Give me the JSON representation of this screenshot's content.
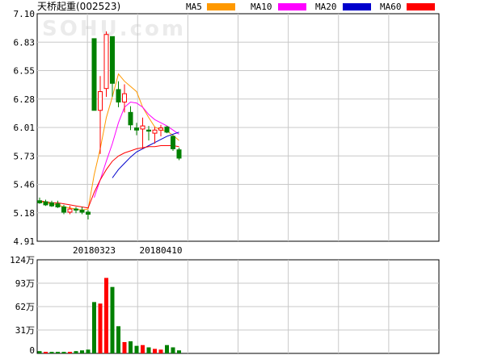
{
  "title": "天桥起重(002523)",
  "watermark": "SOHU.com",
  "legend": [
    {
      "label": "MA5",
      "color": "#ff9900"
    },
    {
      "label": "MA10",
      "color": "#ff00ff"
    },
    {
      "label": "MA20",
      "color": "#0000cc"
    },
    {
      "label": "MA60",
      "color": "#ff0000"
    }
  ],
  "chart_data": [
    {
      "type": "candlestick",
      "ylim": [
        4.91,
        7.1
      ],
      "y_ticks": [
        "7.10",
        "6.83",
        "6.55",
        "6.28",
        "6.01",
        "5.73",
        "5.46",
        "5.18",
        "4.91"
      ],
      "x_tick_labels": [
        {
          "index": 9,
          "label": "20180323"
        },
        {
          "index": 20,
          "label": "20180410"
        }
      ],
      "up_color": "#ff0000",
      "down_color": "#008000",
      "candles": [
        {
          "o": 5.3,
          "h": 5.33,
          "l": 5.27,
          "c": 5.28
        },
        {
          "o": 5.29,
          "h": 5.31,
          "l": 5.25,
          "c": 5.26
        },
        {
          "o": 5.28,
          "h": 5.3,
          "l": 5.24,
          "c": 5.25
        },
        {
          "o": 5.27,
          "h": 5.3,
          "l": 5.23,
          "c": 5.24
        },
        {
          "o": 5.24,
          "h": 5.26,
          "l": 5.17,
          "c": 5.19
        },
        {
          "o": 5.19,
          "h": 5.25,
          "l": 5.17,
          "c": 5.22
        },
        {
          "o": 5.22,
          "h": 5.24,
          "l": 5.18,
          "c": 5.21
        },
        {
          "o": 5.21,
          "h": 5.24,
          "l": 5.17,
          "c": 5.19
        },
        {
          "o": 5.19,
          "h": 5.21,
          "l": 5.12,
          "c": 5.17
        },
        {
          "o": 6.86,
          "h": 6.86,
          "l": 6.17,
          "c": 6.17
        },
        {
          "o": 6.17,
          "h": 6.5,
          "l": 5.75,
          "c": 6.35
        },
        {
          "o": 6.38,
          "h": 6.93,
          "l": 6.3,
          "c": 6.9
        },
        {
          "o": 6.88,
          "h": 6.88,
          "l": 6.3,
          "c": 6.43
        },
        {
          "o": 6.37,
          "h": 6.45,
          "l": 6.2,
          "c": 6.25
        },
        {
          "o": 6.25,
          "h": 6.42,
          "l": 6.15,
          "c": 6.33
        },
        {
          "o": 6.15,
          "h": 6.21,
          "l": 5.98,
          "c": 6.03
        },
        {
          "o": 6.0,
          "h": 6.05,
          "l": 5.93,
          "c": 5.98
        },
        {
          "o": 5.99,
          "h": 6.1,
          "l": 5.8,
          "c": 6.02
        },
        {
          "o": 5.98,
          "h": 6.02,
          "l": 5.88,
          "c": 5.97
        },
        {
          "o": 5.95,
          "h": 6.01,
          "l": 5.85,
          "c": 5.98
        },
        {
          "o": 5.98,
          "h": 6.03,
          "l": 5.92,
          "c": 6.0
        },
        {
          "o": 6.01,
          "h": 6.02,
          "l": 5.95,
          "c": 5.96
        },
        {
          "o": 5.92,
          "h": 5.93,
          "l": 5.78,
          "c": 5.8
        },
        {
          "o": 5.79,
          "h": 5.81,
          "l": 5.69,
          "c": 5.71
        }
      ],
      "ma5": [
        5.29,
        5.28,
        5.27,
        5.26,
        5.24,
        5.23,
        5.22,
        5.21,
        5.22,
        5.55,
        5.8,
        6.1,
        6.3,
        6.52,
        6.45,
        6.4,
        6.35,
        6.2,
        6.1,
        6.01,
        5.98,
        5.97,
        5.93,
        5.88
      ],
      "ma10": [
        null,
        null,
        null,
        null,
        null,
        null,
        null,
        null,
        null,
        5.33,
        5.5,
        5.68,
        5.85,
        6.05,
        6.2,
        6.25,
        6.24,
        6.2,
        6.13,
        6.08,
        6.05,
        6.02,
        5.98,
        5.94
      ],
      "ma20": [
        null,
        null,
        null,
        null,
        null,
        null,
        null,
        null,
        null,
        null,
        null,
        null,
        5.52,
        5.6,
        5.66,
        5.72,
        5.77,
        5.8,
        5.83,
        5.86,
        5.89,
        5.92,
        5.94,
        5.96
      ],
      "ma60": [
        5.3,
        5.29,
        5.28,
        5.28,
        5.27,
        5.26,
        5.25,
        5.24,
        5.23,
        5.38,
        5.5,
        5.6,
        5.68,
        5.73,
        5.76,
        5.78,
        5.8,
        5.81,
        5.82,
        5.82,
        5.83,
        5.83,
        5.83,
        5.82
      ]
    },
    {
      "type": "bar",
      "ylim": [
        0,
        124
      ],
      "y_ticks": [
        "124万",
        "93万",
        "62万",
        "31万",
        "0"
      ],
      "unit": "万",
      "values": [
        3,
        2,
        2,
        2,
        2,
        2,
        3,
        4,
        5,
        68,
        66,
        100,
        88,
        36,
        15,
        16,
        10,
        11,
        8,
        6,
        5,
        11,
        8,
        4
      ],
      "directions": [
        "down",
        "up",
        "down",
        "down",
        "down",
        "up",
        "down",
        "down",
        "down",
        "down",
        "up",
        "up",
        "down",
        "down",
        "up",
        "down",
        "down",
        "up",
        "down",
        "up",
        "up",
        "down",
        "down",
        "down"
      ]
    }
  ]
}
